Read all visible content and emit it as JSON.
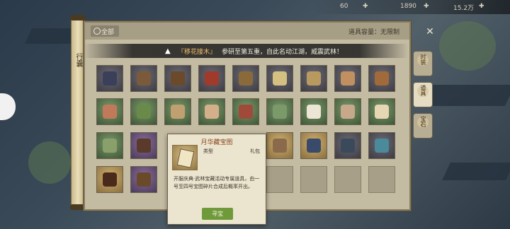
{
  "topbar": {
    "a": "60",
    "b": "1890",
    "c": "15.2万"
  },
  "scroll_tab": {
    "label": "行囊"
  },
  "panel": {
    "tab_all": "全部",
    "capacity": "道具容量：无限制",
    "announce_part1": "『移花接木』",
    "announce_part2": "参研至第五重，自此名动江湖，威震武林！"
  },
  "side_tabs": [
    {
      "label": "时装"
    },
    {
      "label": "道具"
    },
    {
      "label": "宝石"
    }
  ],
  "popup": {
    "title": "月华藏宝图",
    "type_label": "类型",
    "type_value": "礼包",
    "description": "开服庆典·武林宝藏活动专属道具，由一号至四号宝图碎片合成后概率开出。",
    "button": "寻宝"
  }
}
